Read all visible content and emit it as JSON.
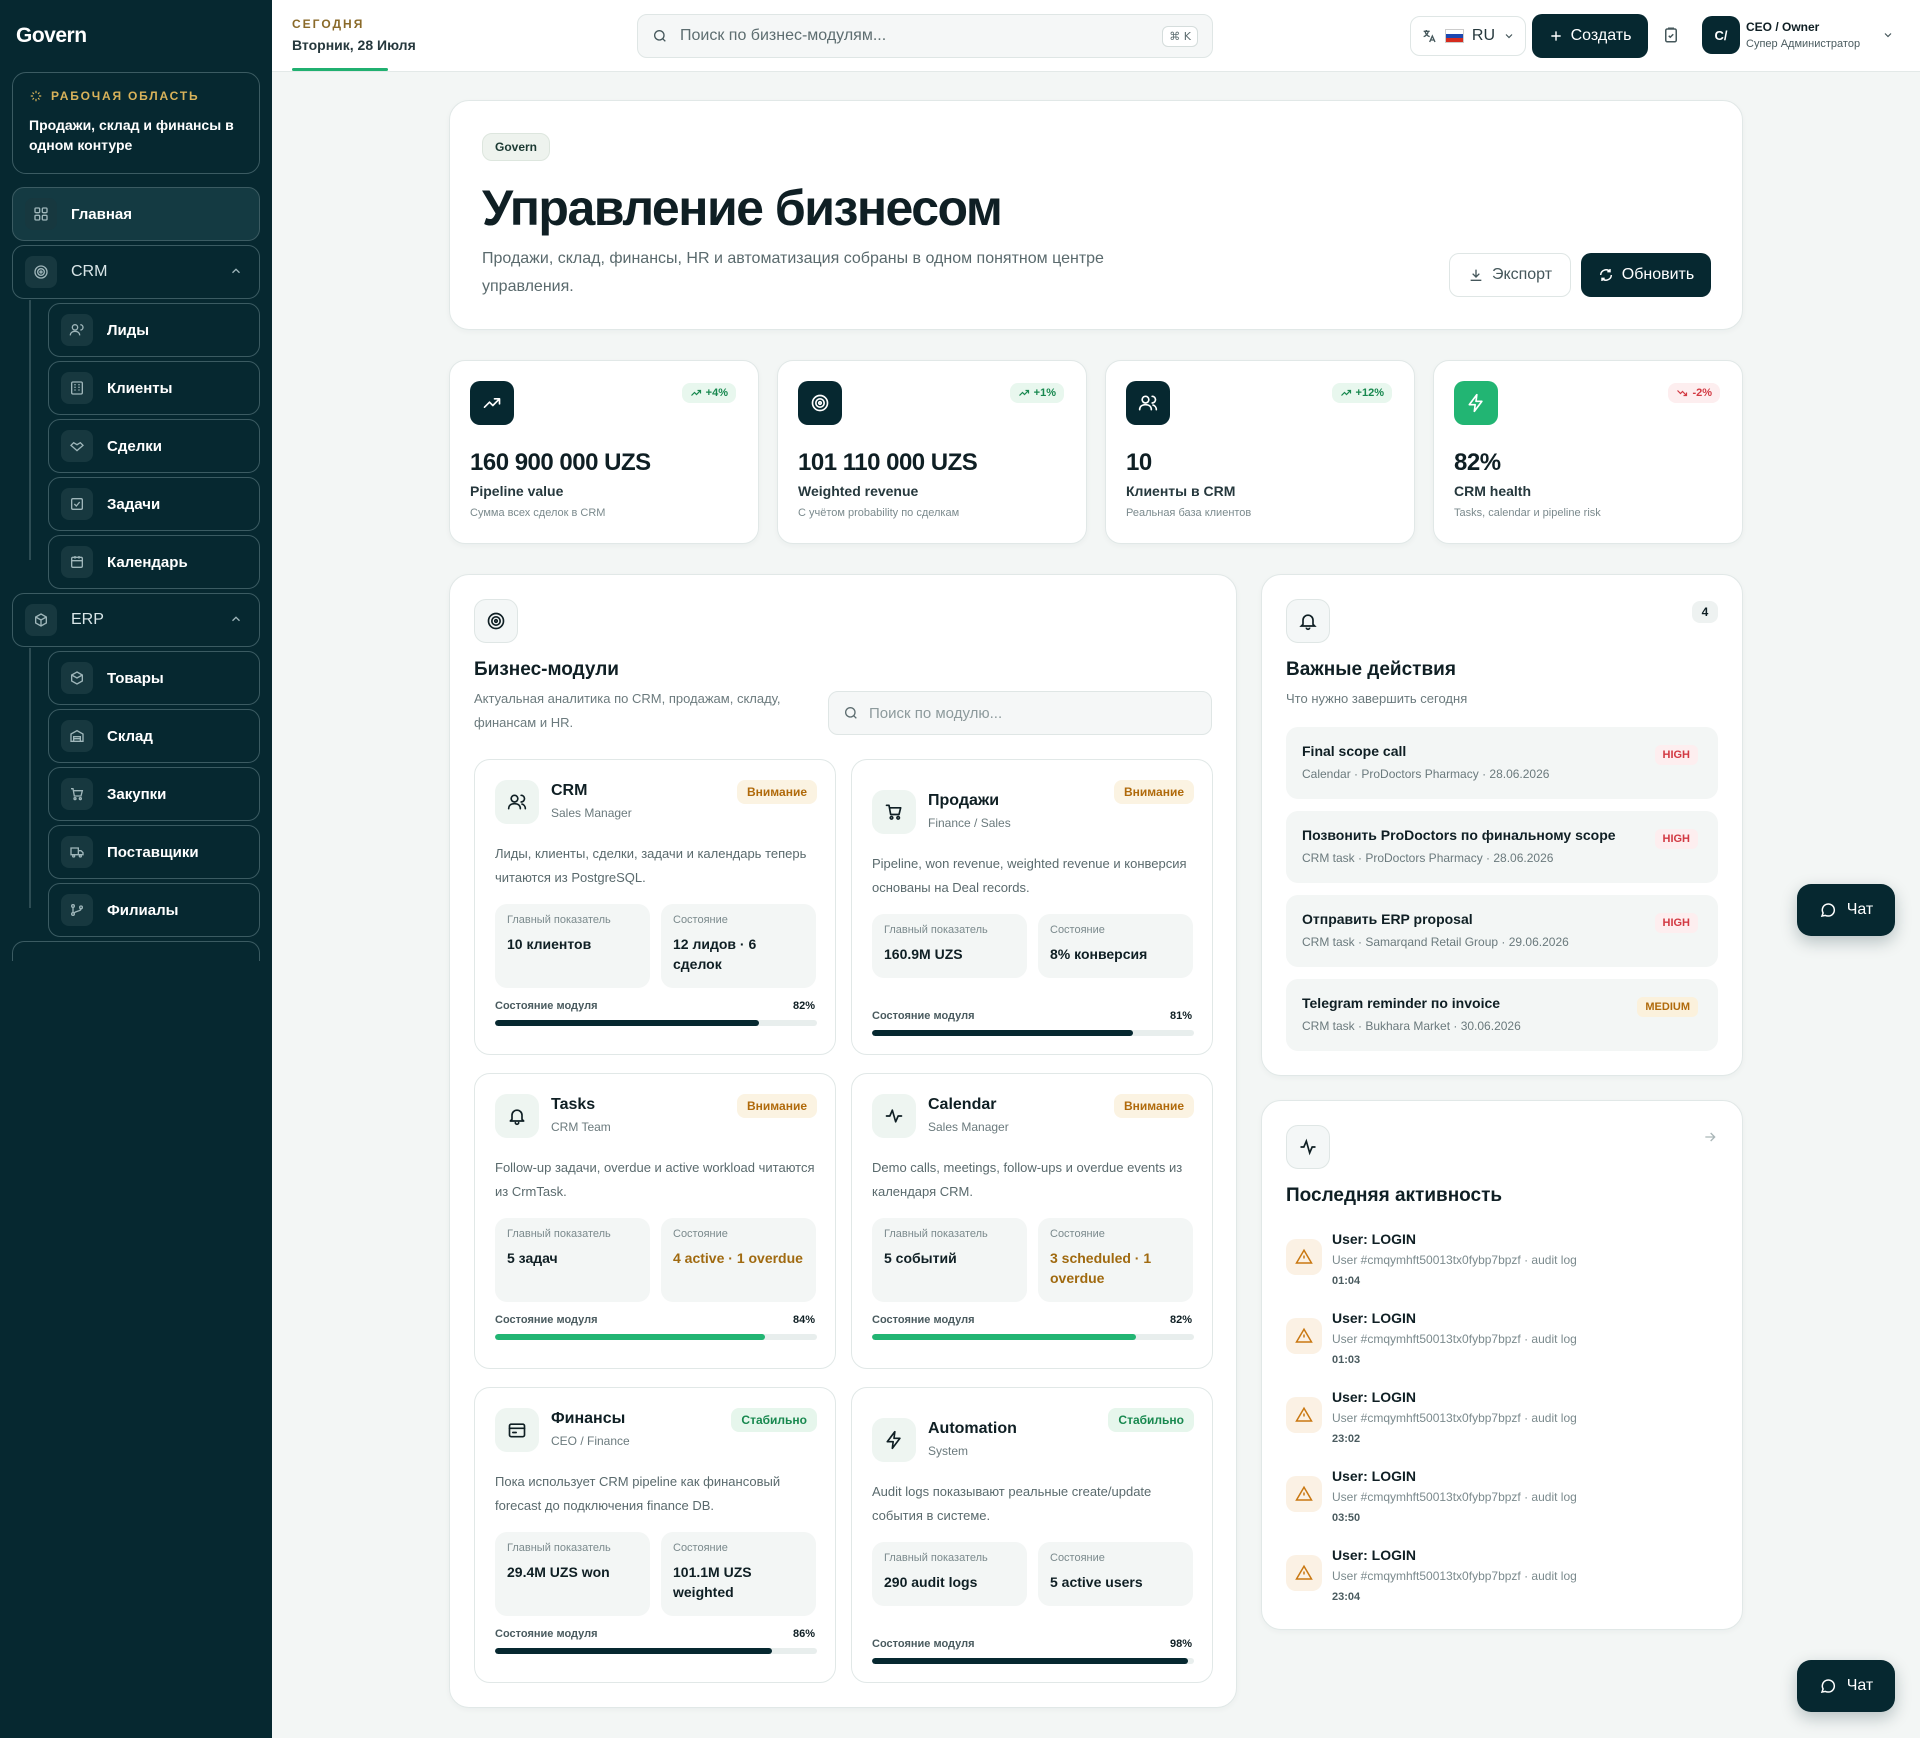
{
  "app": {
    "logo": "Govern"
  },
  "workspace": {
    "label": "РАБОЧАЯ ОБЛАСТЬ",
    "title": "Продажи, склад и финансы в одном контуре"
  },
  "nav": {
    "home": "Главная",
    "crm": {
      "label": "CRM",
      "items": [
        "Лиды",
        "Клиенты",
        "Сделки",
        "Задачи",
        "Календарь"
      ]
    },
    "erp": {
      "label": "ERP",
      "items": [
        "Товары",
        "Склад",
        "Закупки",
        "Поставщики",
        "Филиалы"
      ]
    }
  },
  "header": {
    "today_label": "СЕГОДНЯ",
    "today_date": "Вторник, 28 Июля",
    "search_placeholder": "Поиск по бизнес-модулям...",
    "shortcut": "⌘ K",
    "lang": "RU",
    "create": "Создать",
    "avatar": "C/",
    "user_role": "CEO / Owner",
    "user_sub": "Супер Администратор"
  },
  "hero": {
    "badge": "Govern",
    "title": "Управление бизнесом",
    "desc": "Продажи, склад, финансы, HR и автоматизация собраны в одном понятном центре управления.",
    "export": "Экспорт",
    "refresh": "Обновить"
  },
  "stats": [
    {
      "value": "160 900 000 UZS",
      "label": "Pipeline value",
      "sub": "Сумма всех сделок в CRM",
      "delta": "+4%",
      "trend": "up",
      "icon": "trend-up-icon",
      "icon_bg": "#062830"
    },
    {
      "value": "101 110 000 UZS",
      "label": "Weighted revenue",
      "sub": "С учётом probability по сделкам",
      "delta": "+1%",
      "trend": "up",
      "icon": "target-icon",
      "icon_bg": "#062830"
    },
    {
      "value": "10",
      "label": "Клиенты в CRM",
      "sub": "Реальная база клиентов",
      "delta": "+12%",
      "trend": "up",
      "icon": "users-icon",
      "icon_bg": "#062830"
    },
    {
      "value": "82%",
      "label": "CRM health",
      "sub": "Tasks, calendar и pipeline risk",
      "delta": "-2%",
      "trend": "down",
      "icon": "bolt-icon",
      "icon_bg": "#22b573"
    }
  ],
  "modules_section": {
    "title": "Бизнес-модули",
    "desc": "Актуальная аналитика по CRM, продажам, складу, финансам и HR.",
    "search_placeholder": "Поиск по модулю...",
    "metric_label": "Главный показатель",
    "state_label": "Состояние",
    "health_label": "Состояние модуля"
  },
  "modules": [
    {
      "name": "CRM",
      "owner": "Sales Manager",
      "badge": "Внимание",
      "badge_type": "warn",
      "desc": "Лиды, клиенты, сделки, задачи и календарь теперь читаются из PostgreSQL.",
      "metric": "10 клиентов",
      "state": "12 лидов · 6 сделок",
      "state_color": "normal",
      "health": 82,
      "health_label": "82%",
      "bar_color": "#062830",
      "icon": "users-icon"
    },
    {
      "name": "Продажи",
      "owner": "Finance / Sales",
      "badge": "Внимание",
      "badge_type": "warn",
      "desc": "Pipeline, won revenue, weighted revenue и конверсия основаны на Deal records.",
      "metric": "160.9M UZS",
      "state": "8% конверсия",
      "state_color": "normal",
      "health": 81,
      "health_label": "81%",
      "bar_color": "#062830",
      "icon": "cart-icon"
    },
    {
      "name": "Tasks",
      "owner": "CRM Team",
      "badge": "Внимание",
      "badge_type": "warn",
      "desc": "Follow-up задачи, overdue и active workload читаются из CrmTask.",
      "metric": "5 задач",
      "state": "4 active · 1 overdue",
      "state_color": "amber",
      "health": 84,
      "health_label": "84%",
      "bar_color": "#22b573",
      "icon": "bell-icon"
    },
    {
      "name": "Calendar",
      "owner": "Sales Manager",
      "badge": "Внимание",
      "badge_type": "warn",
      "desc": "Demo calls, meetings, follow-ups и overdue events из календаря CRM.",
      "metric": "5 событий",
      "state": "3 scheduled · 1 overdue",
      "state_color": "amber",
      "health": 82,
      "health_label": "82%",
      "bar_color": "#22b573",
      "icon": "pulse-icon"
    },
    {
      "name": "Финансы",
      "owner": "CEO / Finance",
      "badge": "Стабильно",
      "badge_type": "ok",
      "desc": "Пока использует CRM pipeline как финансовый forecast до подключения finance DB.",
      "metric": "29.4M UZS won",
      "state": "101.1M UZS weighted",
      "state_color": "normal",
      "health": 86,
      "health_label": "86%",
      "bar_color": "#062830",
      "icon": "wallet-icon"
    },
    {
      "name": "Automation",
      "owner": "System",
      "badge": "Стабильно",
      "badge_type": "ok",
      "desc": "Audit logs показывают реальные create/update события в системе.",
      "metric": "290 audit logs",
      "state": "5 active users",
      "state_color": "normal",
      "health": 98,
      "health_label": "98%",
      "bar_color": "#062830",
      "icon": "bolt-icon"
    }
  ],
  "actions": {
    "title": "Важные действия",
    "desc": "Что нужно завершить сегодня",
    "count": "4",
    "items": [
      {
        "title": "Final scope call",
        "meta": "Calendar · ProDoctors Pharmacy · 28.06.2026",
        "priority": "HIGH",
        "level": "high"
      },
      {
        "title": "Позвонить ProDoctors по финальному scope",
        "meta": "CRM task · ProDoctors Pharmacy · 28.06.2026",
        "priority": "HIGH",
        "level": "high"
      },
      {
        "title": "Отправить ERP proposal",
        "meta": "CRM task · Samarqand Retail Group · 29.06.2026",
        "priority": "HIGH",
        "level": "high"
      },
      {
        "title": "Telegram reminder по invoice",
        "meta": "CRM task · Bukhara Market · 30.06.2026",
        "priority": "MEDIUM",
        "level": "medium"
      }
    ]
  },
  "activity": {
    "title": "Последняя активность",
    "items": [
      {
        "title": "User: LOGIN",
        "meta": "User #cmqymhft50013tx0fybp7bpzf · audit log",
        "time": "01:04"
      },
      {
        "title": "User: LOGIN",
        "meta": "User #cmqymhft50013tx0fybp7bpzf · audit log",
        "time": "01:03"
      },
      {
        "title": "User: LOGIN",
        "meta": "User #cmqymhft50013tx0fybp7bpzf · audit log",
        "time": "23:02"
      },
      {
        "title": "User: LOGIN",
        "meta": "User #cmqymhft50013tx0fybp7bpzf · audit log",
        "time": "03:50"
      },
      {
        "title": "User: LOGIN",
        "meta": "User #cmqymhft50013tx0fybp7bpzf · audit log",
        "time": "23:04"
      }
    ]
  },
  "chat": {
    "label": "Чат"
  },
  "colors": {
    "sidebar": "#062830",
    "accent": "#22b573",
    "warn": "#b06a0b",
    "danger": "#d23a43"
  }
}
